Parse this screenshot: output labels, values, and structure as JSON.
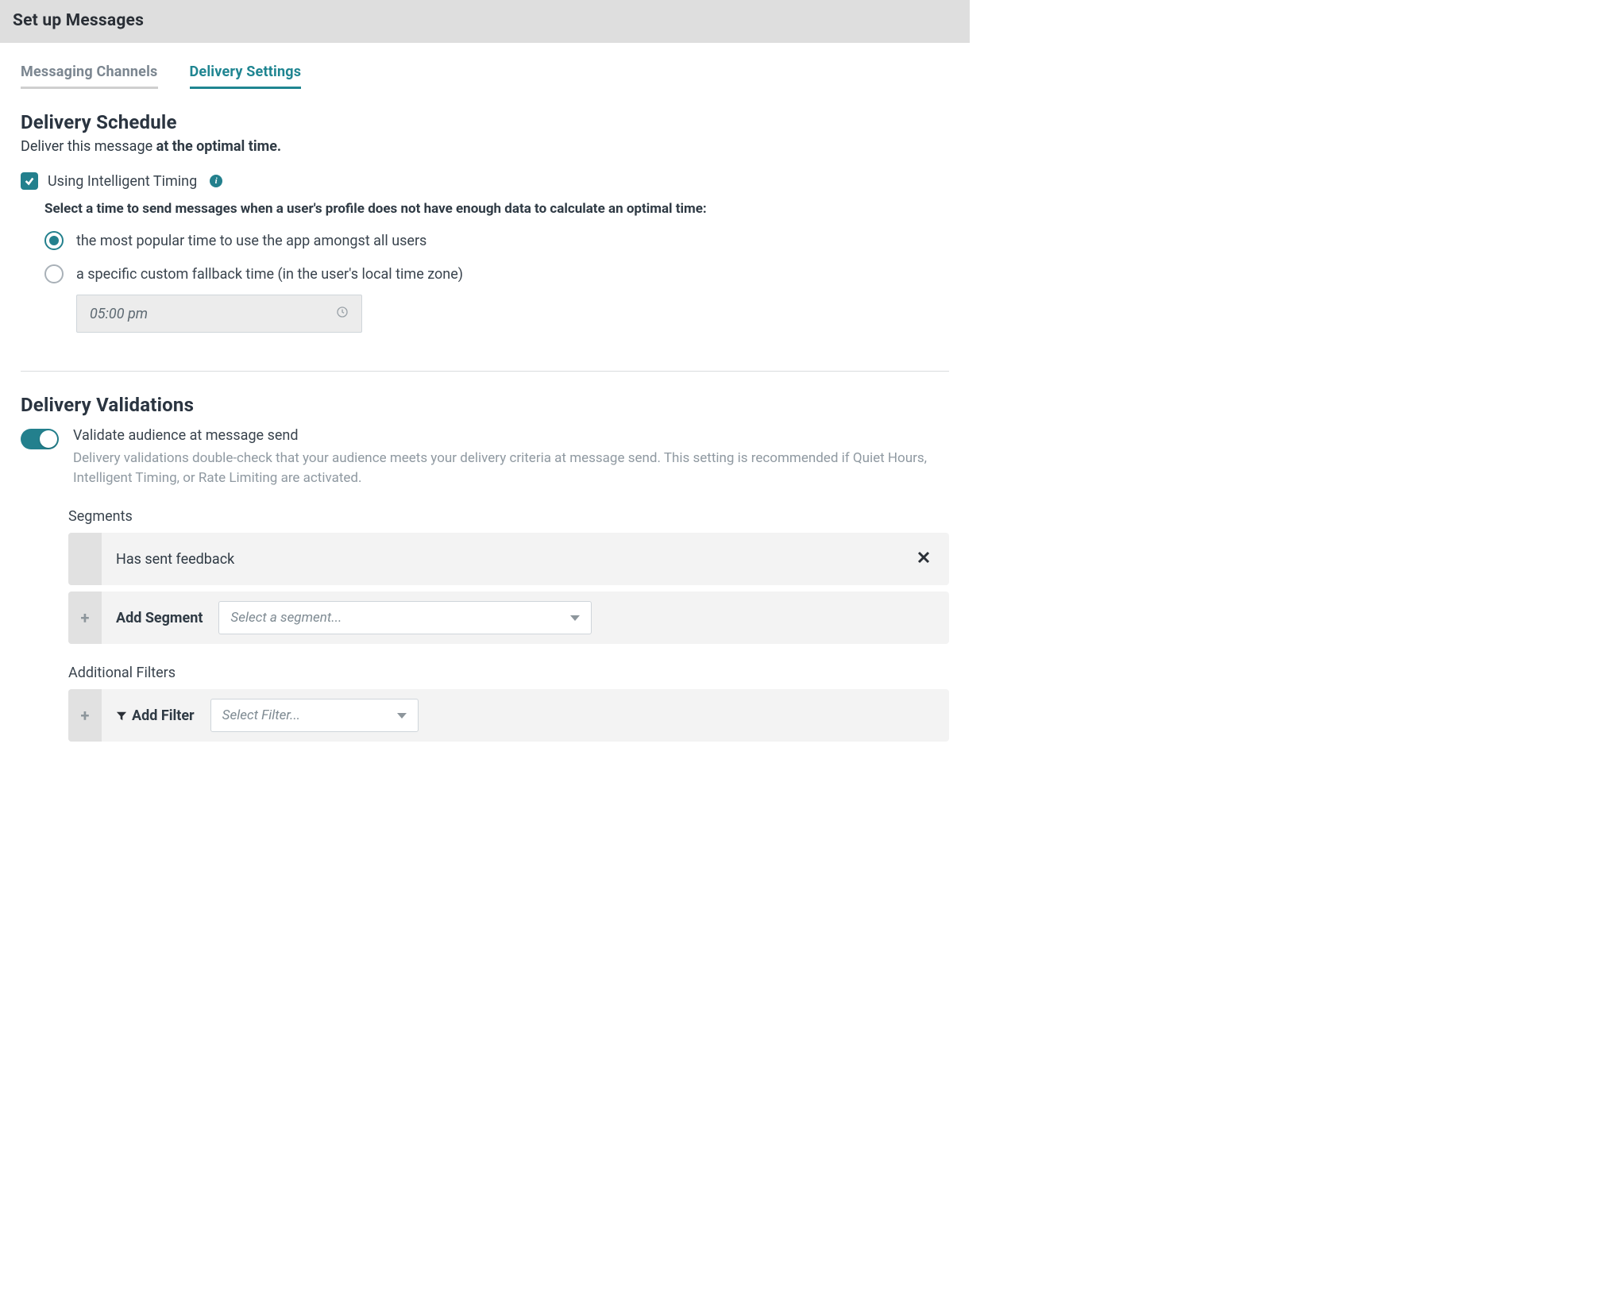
{
  "header": {
    "title": "Set up Messages"
  },
  "tabs": {
    "channels": "Messaging Channels",
    "delivery": "Delivery Settings"
  },
  "schedule": {
    "title": "Delivery Schedule",
    "sub_prefix": "Deliver this message ",
    "sub_bold": "at the optimal time.",
    "timing_checkbox": "Using Intelligent Timing",
    "fallback_prompt": "Select a time to send messages when a user's profile does not have enough data to calculate an optimal time:",
    "radio_popular": "the most popular time to use the app amongst all users",
    "radio_custom": "a specific custom fallback time (in the user's local time zone)",
    "time_value": "05:00 pm"
  },
  "validations": {
    "title": "Delivery Validations",
    "toggle_label": "Validate audience at message send",
    "toggle_desc": "Delivery validations double-check that your audience meets your delivery criteria at message send. This setting is recommended if Quiet Hours, Intelligent Timing, or Rate Limiting are activated.",
    "segments_label": "Segments",
    "segment_item": "Has sent feedback",
    "add_segment_label": "Add Segment",
    "segment_placeholder": "Select a segment...",
    "filters_label": "Additional Filters",
    "add_filter_label": "Add Filter",
    "filter_placeholder": "Select Filter..."
  }
}
